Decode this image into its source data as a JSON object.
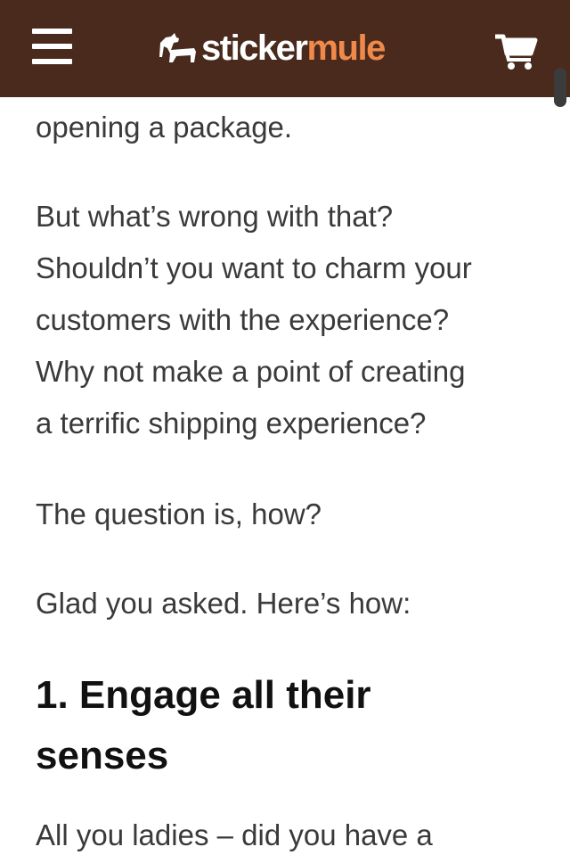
{
  "header": {
    "logo_sticker": "sticker",
    "logo_mule": "mule",
    "menu_icon": "hamburger-menu-icon",
    "cart_icon": "shopping-cart-icon",
    "colors": {
      "background": "#4a2a1d",
      "logo_accent": "#f08a4b",
      "logo_primary": "#ffffff"
    }
  },
  "article": {
    "p0_line1": "opening a package.",
    "p1_line1": "But what’s wrong with that?",
    "p1_line2": "Shouldn’t you want to charm your",
    "p1_line3": "customers with the experience?",
    "p1_line4": "Why not make a point of creating",
    "p1_line5": "a terrific shipping experience?",
    "p2_line1": "The question is, how?",
    "p3_line1": "Glad you asked. Here’s how:",
    "h1_line1": "1. Engage all their",
    "h1_line2": "senses",
    "p4_line1": "All you ladies – did you have a"
  }
}
